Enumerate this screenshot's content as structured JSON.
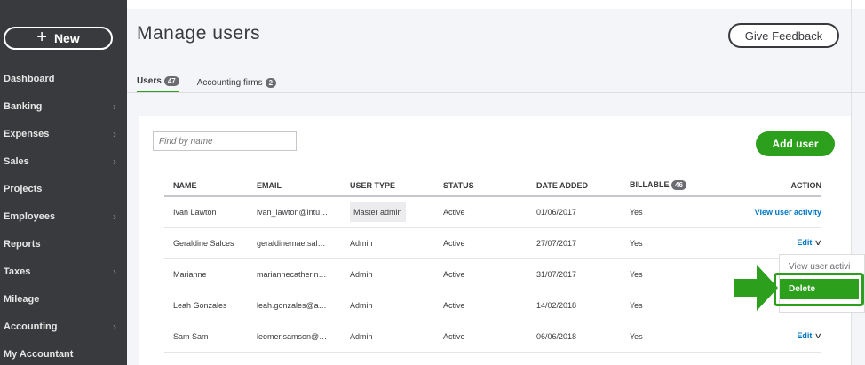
{
  "sidebar": {
    "new_label": "New",
    "items": [
      {
        "label": "Dashboard",
        "chevron": false
      },
      {
        "label": "Banking",
        "chevron": true
      },
      {
        "label": "Expenses",
        "chevron": true
      },
      {
        "label": "Sales",
        "chevron": true
      },
      {
        "label": "Projects",
        "chevron": false
      },
      {
        "label": "Employees",
        "chevron": true
      },
      {
        "label": "Reports",
        "chevron": false
      },
      {
        "label": "Taxes",
        "chevron": true
      },
      {
        "label": "Mileage",
        "chevron": false
      },
      {
        "label": "Accounting",
        "chevron": true
      },
      {
        "label": "My Accountant",
        "chevron": false
      }
    ]
  },
  "header": {
    "title": "Manage users",
    "feedback_label": "Give Feedback"
  },
  "tabs": [
    {
      "label": "Users",
      "count": "47",
      "active": true
    },
    {
      "label": "Accounting firms",
      "count": "2",
      "active": false
    }
  ],
  "search": {
    "placeholder": "Find by name"
  },
  "add_user_label": "Add user",
  "table": {
    "headers": {
      "name": "NAME",
      "email": "EMAIL",
      "user_type": "USER TYPE",
      "status": "STATUS",
      "date_added": "DATE ADDED",
      "billable": "BILLABLE",
      "billable_count": "46",
      "action": "ACTION"
    },
    "rows": [
      {
        "name": "Ivan Lawton",
        "email": "ivan_lawton@intu…",
        "user_type": "Master admin",
        "status": "Active",
        "date_added": "01/06/2017",
        "billable": "Yes",
        "action": "View user activity"
      },
      {
        "name": "Geraldine Salces",
        "email": "geraldinemae.sal…",
        "user_type": "Admin",
        "status": "Active",
        "date_added": "27/07/2017",
        "billable": "Yes",
        "action": "Edit"
      },
      {
        "name": "Marianne",
        "email": "mariannecatherin…",
        "user_type": "Admin",
        "status": "Active",
        "date_added": "31/07/2017",
        "billable": "Yes",
        "action": ""
      },
      {
        "name": "Leah Gonzales",
        "email": "leah.gonzales@a…",
        "user_type": "Admin",
        "status": "Active",
        "date_added": "14/02/2018",
        "billable": "Yes",
        "action": ""
      },
      {
        "name": "Sam Sam",
        "email": "leomer.samson@…",
        "user_type": "Admin",
        "status": "Active",
        "date_added": "06/06/2018",
        "billable": "Yes",
        "action": "Edit"
      }
    ]
  },
  "dropdown": {
    "view_label": "View user activi",
    "delete_label": "Delete"
  },
  "colors": {
    "accent": "#2ca01c",
    "sidebar": "#393a3d",
    "link": "#0077c5"
  }
}
